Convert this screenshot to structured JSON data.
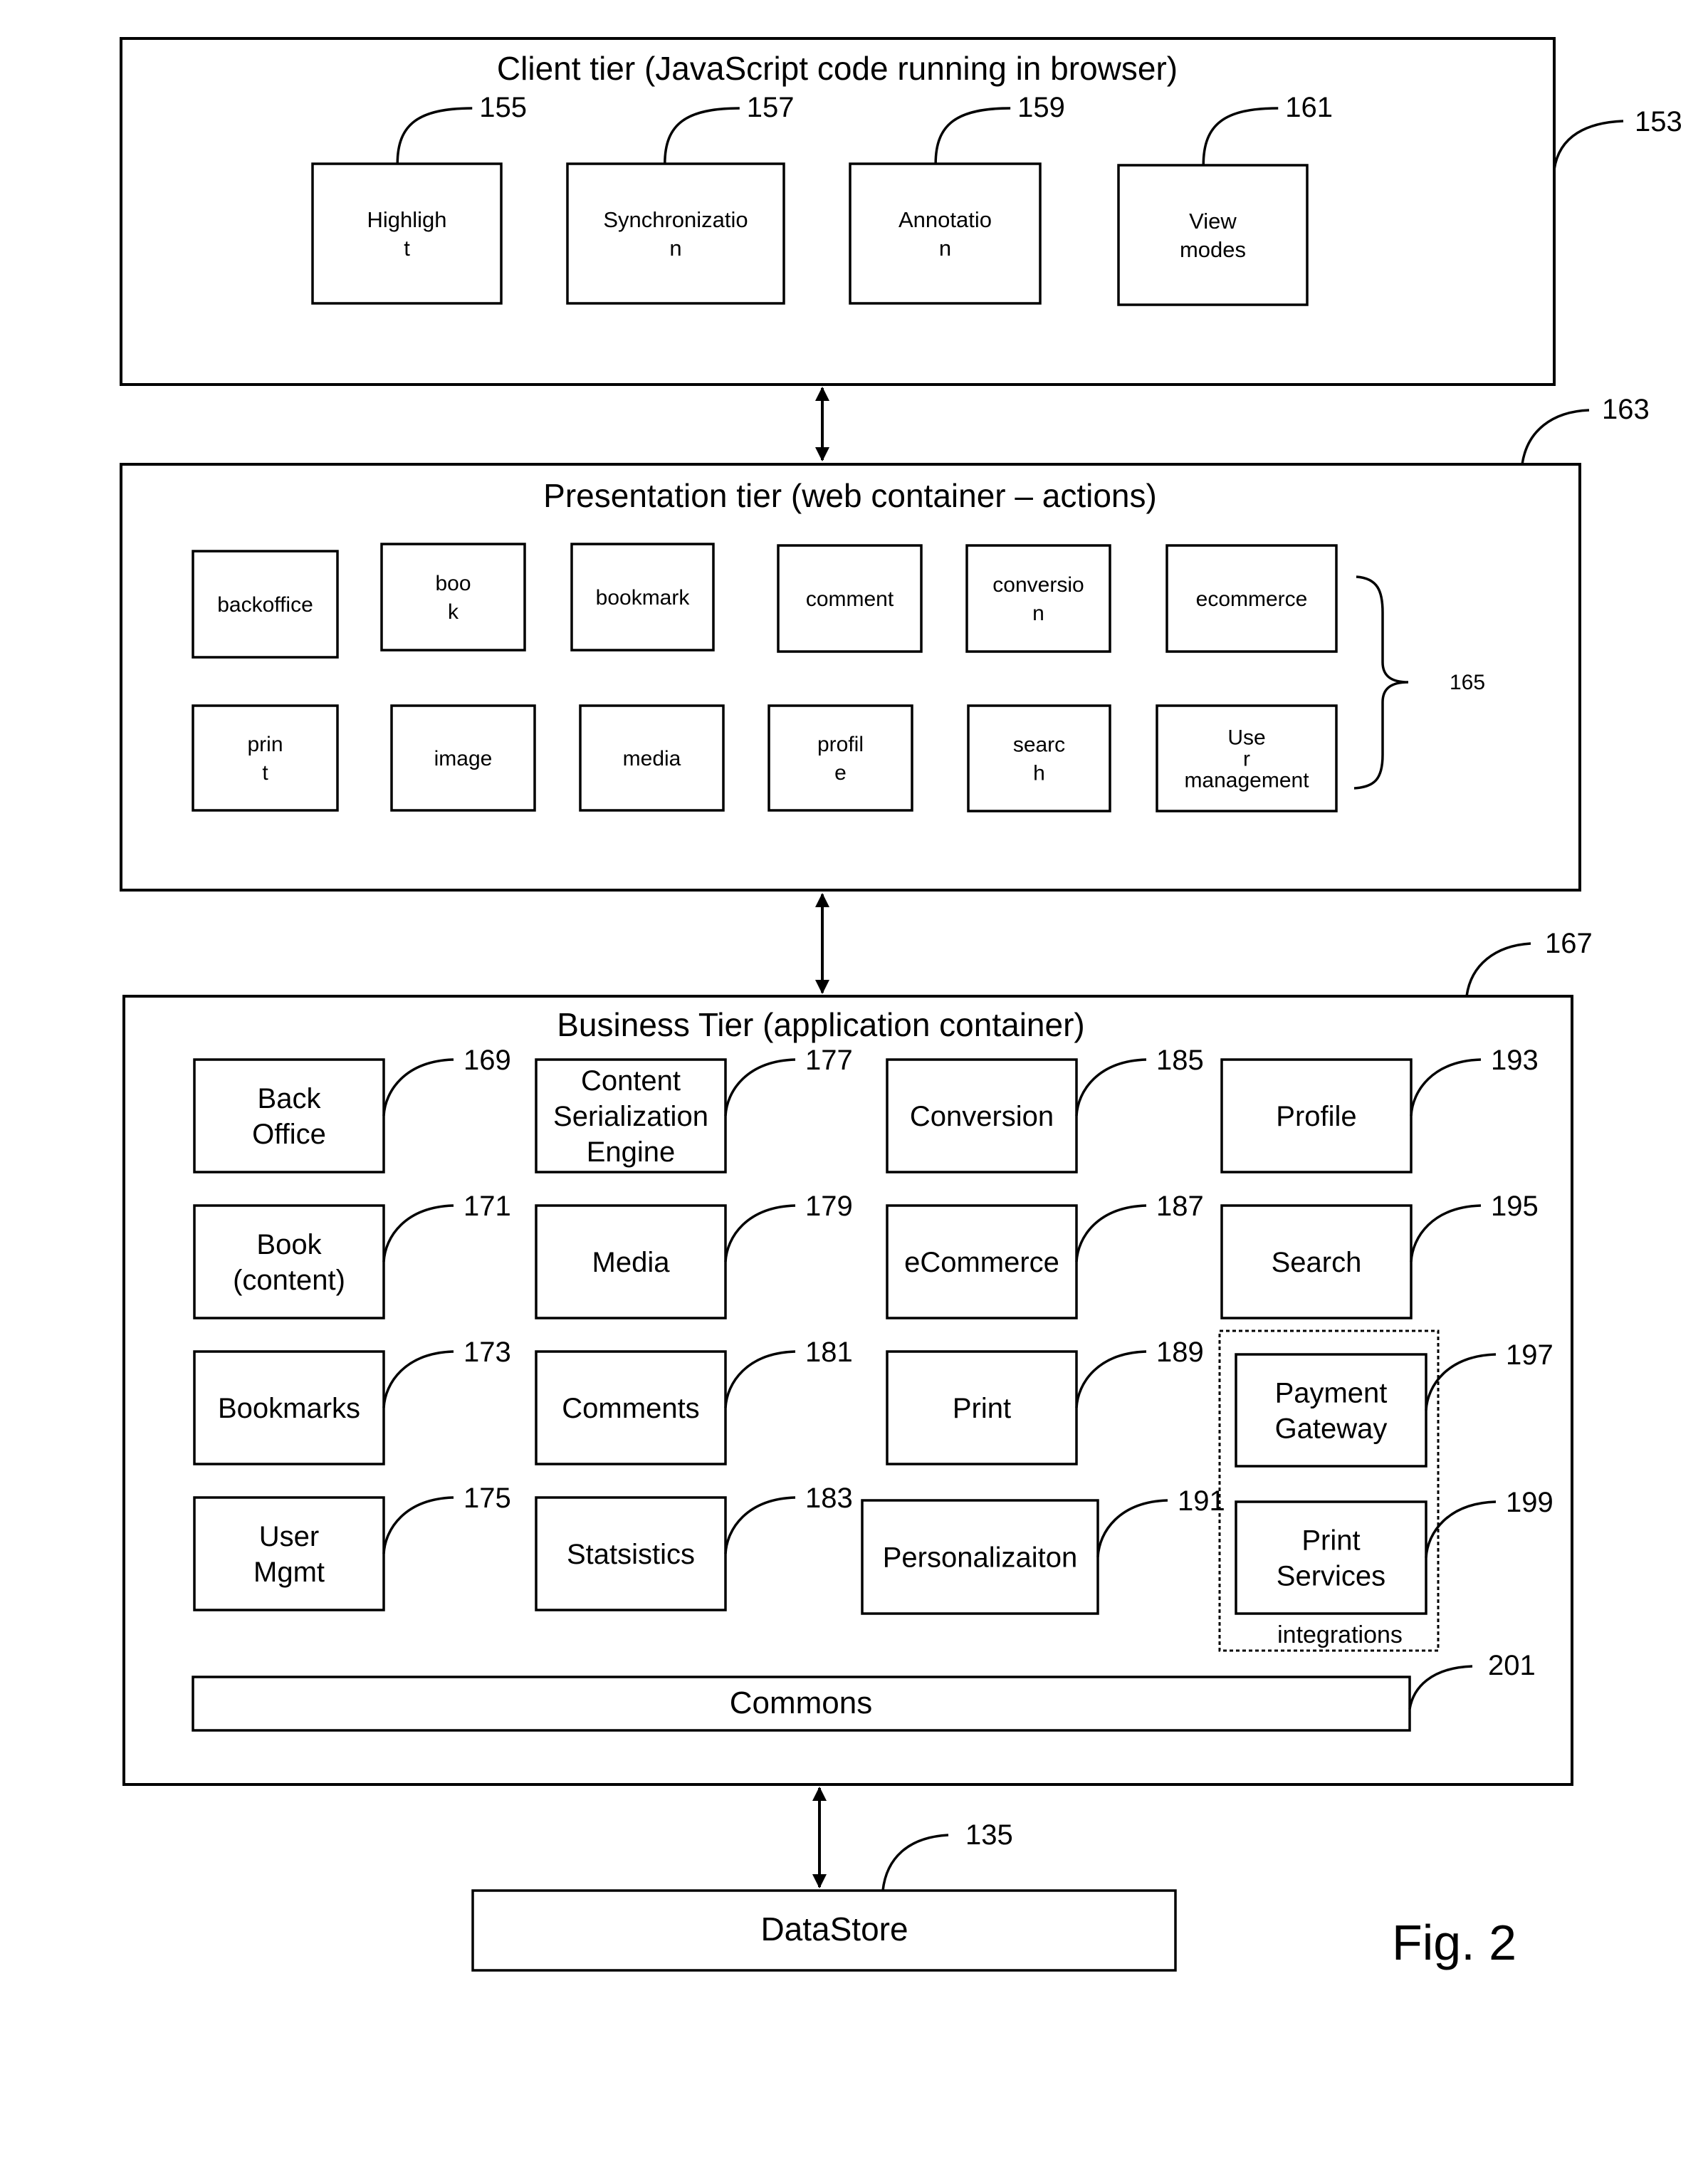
{
  "figure_label": "Fig. 2",
  "client_tier": {
    "title": "Client tier (JavaScript code running in browser)",
    "ref": "153",
    "modules": [
      {
        "lines": [
          "Highligh",
          "t"
        ],
        "ref": "155"
      },
      {
        "lines": [
          "Synchronizatio",
          "n"
        ],
        "ref": "157"
      },
      {
        "lines": [
          "Annotatio",
          "n"
        ],
        "ref": "159"
      },
      {
        "lines": [
          "View",
          "modes"
        ],
        "ref": "161"
      }
    ]
  },
  "presentation_tier": {
    "title": "Presentation tier (web container – actions)",
    "ref": "163",
    "group_ref": "165",
    "actions_row1": [
      {
        "lines": [
          "backoffice"
        ]
      },
      {
        "lines": [
          "boo",
          "k"
        ]
      },
      {
        "lines": [
          "bookmark"
        ]
      },
      {
        "lines": [
          "comment"
        ]
      },
      {
        "lines": [
          "conversio",
          "n"
        ]
      },
      {
        "lines": [
          "ecommerce"
        ]
      }
    ],
    "actions_row2": [
      {
        "lines": [
          "prin",
          "t"
        ]
      },
      {
        "lines": [
          "image"
        ]
      },
      {
        "lines": [
          "media"
        ]
      },
      {
        "lines": [
          "profil",
          "e"
        ]
      },
      {
        "lines": [
          "searc",
          "h"
        ]
      },
      {
        "lines": [
          "Use",
          "r",
          "management"
        ]
      }
    ]
  },
  "business_tier": {
    "title": "Business Tier (application container)",
    "ref": "167",
    "components": [
      {
        "lines": [
          "Back",
          "Office"
        ],
        "ref": "169"
      },
      {
        "lines": [
          "Book",
          "(content)"
        ],
        "ref": "171"
      },
      {
        "lines": [
          "Bookmarks"
        ],
        "ref": "173"
      },
      {
        "lines": [
          "User",
          "Mgmt"
        ],
        "ref": "175"
      },
      {
        "lines": [
          "Content",
          "Serialization",
          "Engine"
        ],
        "ref": "177"
      },
      {
        "lines": [
          "Media"
        ],
        "ref": "179"
      },
      {
        "lines": [
          "Comments"
        ],
        "ref": "181"
      },
      {
        "lines": [
          "Statsistics"
        ],
        "ref": "183"
      },
      {
        "lines": [
          "Conversion"
        ],
        "ref": "185"
      },
      {
        "lines": [
          "eCommerce"
        ],
        "ref": "187"
      },
      {
        "lines": [
          "Print"
        ],
        "ref": "189"
      },
      {
        "lines": [
          "Personalizaiton"
        ],
        "ref": "191"
      },
      {
        "lines": [
          "Profile"
        ],
        "ref": "193"
      },
      {
        "lines": [
          "Search"
        ],
        "ref": "195"
      },
      {
        "lines": [
          "Payment",
          "Gateway"
        ],
        "ref": "197"
      },
      {
        "lines": [
          "Print",
          "Services"
        ],
        "ref": "199"
      }
    ],
    "integrations_label": "integrations",
    "commons": {
      "label": "Commons",
      "ref": "201"
    }
  },
  "datastore": {
    "label": "DataStore",
    "ref": "135"
  }
}
